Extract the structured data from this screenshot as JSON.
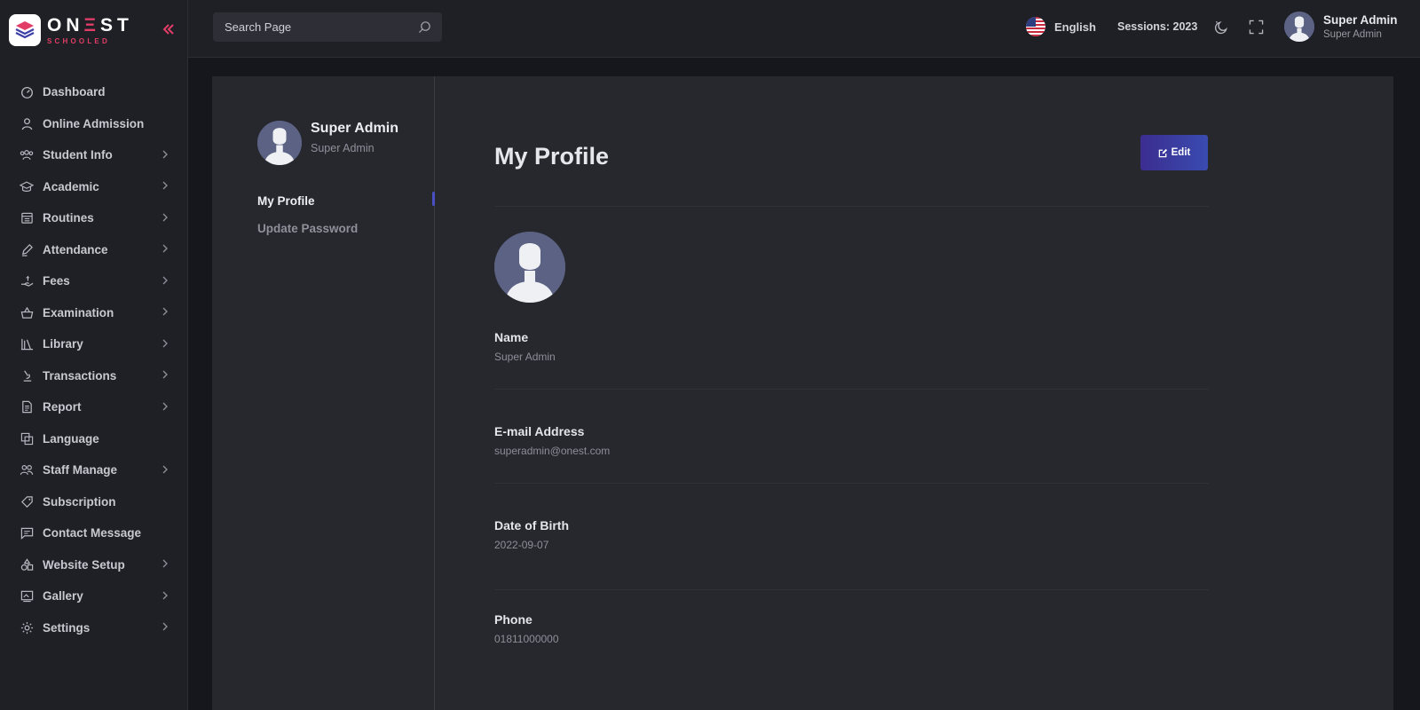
{
  "brand": {
    "name_part1": "ON",
    "name_accent": "Ξ",
    "name_part2": "ST",
    "subtitle": "SCHOOLED"
  },
  "sidebar": {
    "collapse_icon": "double-chevron-left-icon",
    "items": [
      {
        "label": "Dashboard",
        "icon": "gauge-icon",
        "chevron": false
      },
      {
        "label": "Online Admission",
        "icon": "user-icon",
        "chevron": false
      },
      {
        "label": "Student Info",
        "icon": "users-icon",
        "chevron": true
      },
      {
        "label": "Academic",
        "icon": "graduation-cap-icon",
        "chevron": true
      },
      {
        "label": "Routines",
        "icon": "calendar-icon",
        "chevron": true
      },
      {
        "label": "Attendance",
        "icon": "pen-icon",
        "chevron": true
      },
      {
        "label": "Fees",
        "icon": "hand-coin-icon",
        "chevron": true
      },
      {
        "label": "Examination",
        "icon": "basket-icon",
        "chevron": true
      },
      {
        "label": "Library",
        "icon": "books-icon",
        "chevron": true
      },
      {
        "label": "Transactions",
        "icon": "microscope-icon",
        "chevron": true
      },
      {
        "label": "Report",
        "icon": "file-icon",
        "chevron": true
      },
      {
        "label": "Language",
        "icon": "translate-icon",
        "chevron": false
      },
      {
        "label": "Staff Manage",
        "icon": "users-icon",
        "chevron": true
      },
      {
        "label": "Subscription",
        "icon": "tag-icon",
        "chevron": false
      },
      {
        "label": "Contact Message",
        "icon": "message-icon",
        "chevron": false
      },
      {
        "label": "Website Setup",
        "icon": "shapes-icon",
        "chevron": true
      },
      {
        "label": "Gallery",
        "icon": "gallery-icon",
        "chevron": true
      },
      {
        "label": "Settings",
        "icon": "gear-icon",
        "chevron": true
      }
    ]
  },
  "topbar": {
    "search_placeholder": "Search Page",
    "language": "English",
    "session": "Sessions: 2023",
    "user_name": "Super Admin",
    "user_role": "Super Admin"
  },
  "profile_nav": {
    "name": "Super Admin",
    "role": "Super Admin",
    "links": [
      "My Profile",
      "Update Password"
    ]
  },
  "profile": {
    "title": "My Profile",
    "edit_label": "Edit",
    "fields": [
      {
        "label": "Name",
        "value": "Super Admin"
      },
      {
        "label": "E-mail Address",
        "value": "superadmin@onest.com"
      },
      {
        "label": "Date of Birth",
        "value": "2022-09-07"
      },
      {
        "label": "Phone",
        "value": "01811000000"
      }
    ]
  },
  "colors": {
    "accent": "#e23d66",
    "primary_button": "#3b3fa6",
    "background": "#16171c",
    "panel": "#1f2026",
    "card": "#27282e"
  }
}
